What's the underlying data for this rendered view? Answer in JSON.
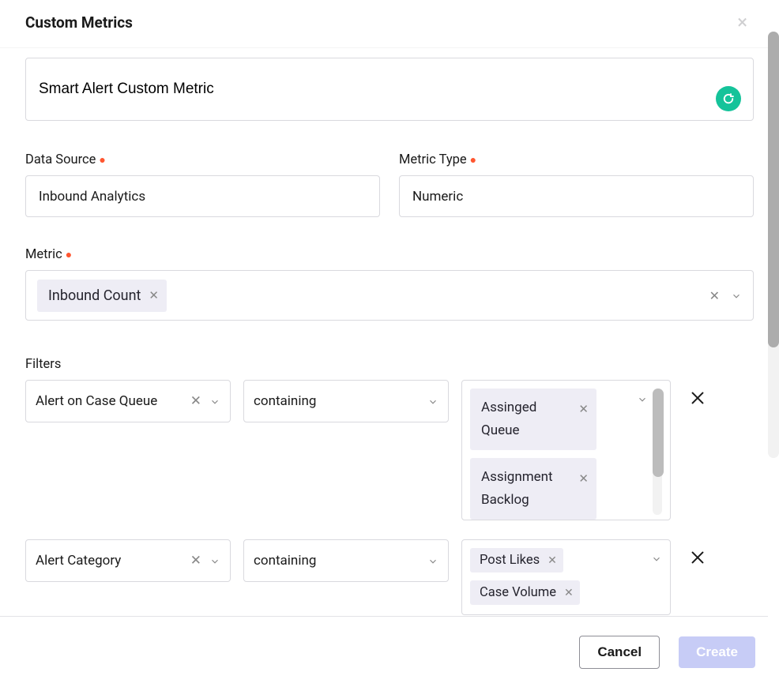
{
  "modal": {
    "title": "Custom Metrics",
    "close_icon": "×"
  },
  "name": {
    "value": "Smart Alert Custom Metric"
  },
  "fields": {
    "data_source": {
      "label": "Data Source",
      "value": "Inbound Analytics"
    },
    "metric_type": {
      "label": "Metric Type",
      "value": "Numeric"
    },
    "metric": {
      "label": "Metric",
      "chip": "Inbound Count"
    }
  },
  "filters": {
    "label": "Filters",
    "rows": [
      {
        "attribute": "Alert on Case Queue",
        "operator": "containing",
        "values": [
          "Assinged Queue",
          "Assignment Backlog"
        ]
      },
      {
        "attribute": "Alert Category",
        "operator": "containing",
        "values": [
          "Post Likes",
          "Case Volume"
        ]
      }
    ]
  },
  "footer": {
    "cancel": "Cancel",
    "create": "Create"
  }
}
